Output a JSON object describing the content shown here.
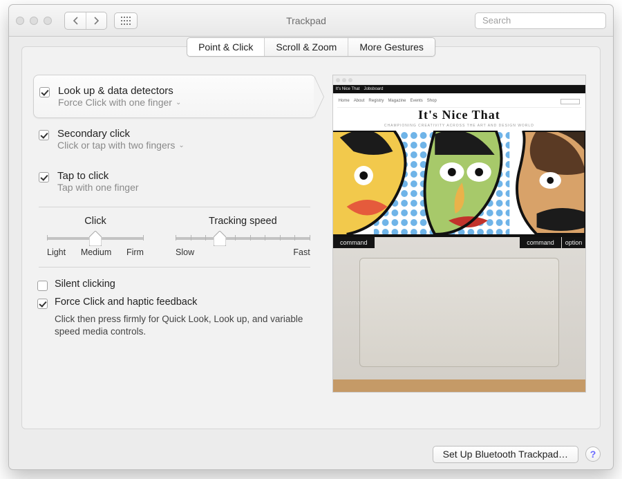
{
  "window": {
    "title": "Trackpad",
    "search_placeholder": "Search"
  },
  "tabs": [
    {
      "label": "Point & Click",
      "active": true
    },
    {
      "label": "Scroll & Zoom",
      "active": false
    },
    {
      "label": "More Gestures",
      "active": false
    }
  ],
  "options": {
    "lookup": {
      "checked": true,
      "title": "Look up & data detectors",
      "subtitle": "Force Click with one finger"
    },
    "secondary": {
      "checked": true,
      "title": "Secondary click",
      "subtitle": "Click or tap with two fingers"
    },
    "tap": {
      "checked": true,
      "title": "Tap to click",
      "subtitle": "Tap with one finger"
    }
  },
  "sliders": {
    "click": {
      "label": "Click",
      "min_label": "Light",
      "mid_label": "Medium",
      "max_label": "Firm",
      "position_pct": 50
    },
    "tracking": {
      "label": "Tracking speed",
      "min_label": "Slow",
      "max_label": "Fast",
      "position_pct": 33
    }
  },
  "bottom": {
    "silent": {
      "checked": false,
      "label": "Silent clicking"
    },
    "force": {
      "checked": true,
      "label": "Force Click and haptic feedback",
      "description": "Click then press firmly for Quick Look, Look up, and variable speed media controls."
    }
  },
  "preview": {
    "strip": {
      "left": "It's Nice That",
      "right": "Jobsboard"
    },
    "brand": "It's Nice That",
    "tagline": "CHAMPIONING CREATIVITY ACROSS THE ART AND DESIGN WORLD",
    "menu": [
      "Home",
      "About",
      "Registry",
      "Magazine",
      "Events",
      "Shop"
    ],
    "keys": {
      "left": "command",
      "right1": "command",
      "right2": "option"
    }
  },
  "footer": {
    "bluetooth_label": "Set Up Bluetooth Trackpad…",
    "help_label": "?"
  }
}
